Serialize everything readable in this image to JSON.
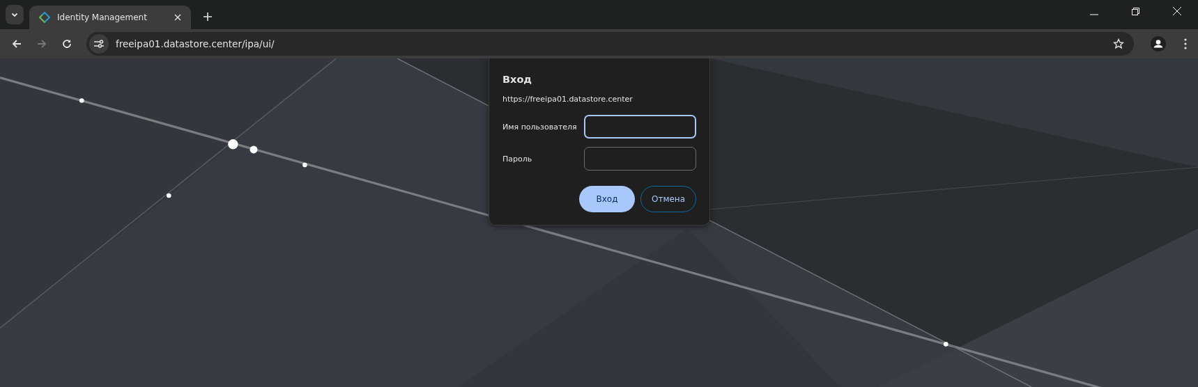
{
  "tabs": [
    {
      "title": "Identity Management",
      "selected": true
    }
  ],
  "address_bar": {
    "url": "freeipa01.datastore.center/ipa/ui/"
  },
  "login_dialog": {
    "title": "Вход",
    "origin": "https://freeipa01.datastore.center",
    "fields": [
      {
        "label": "Имя пользователя",
        "focused": true
      },
      {
        "label": "Пароль",
        "focused": false
      }
    ],
    "buttons": [
      {
        "label": "Вход",
        "kind": "primary"
      },
      {
        "label": "Отмена",
        "kind": "secondary"
      }
    ]
  }
}
